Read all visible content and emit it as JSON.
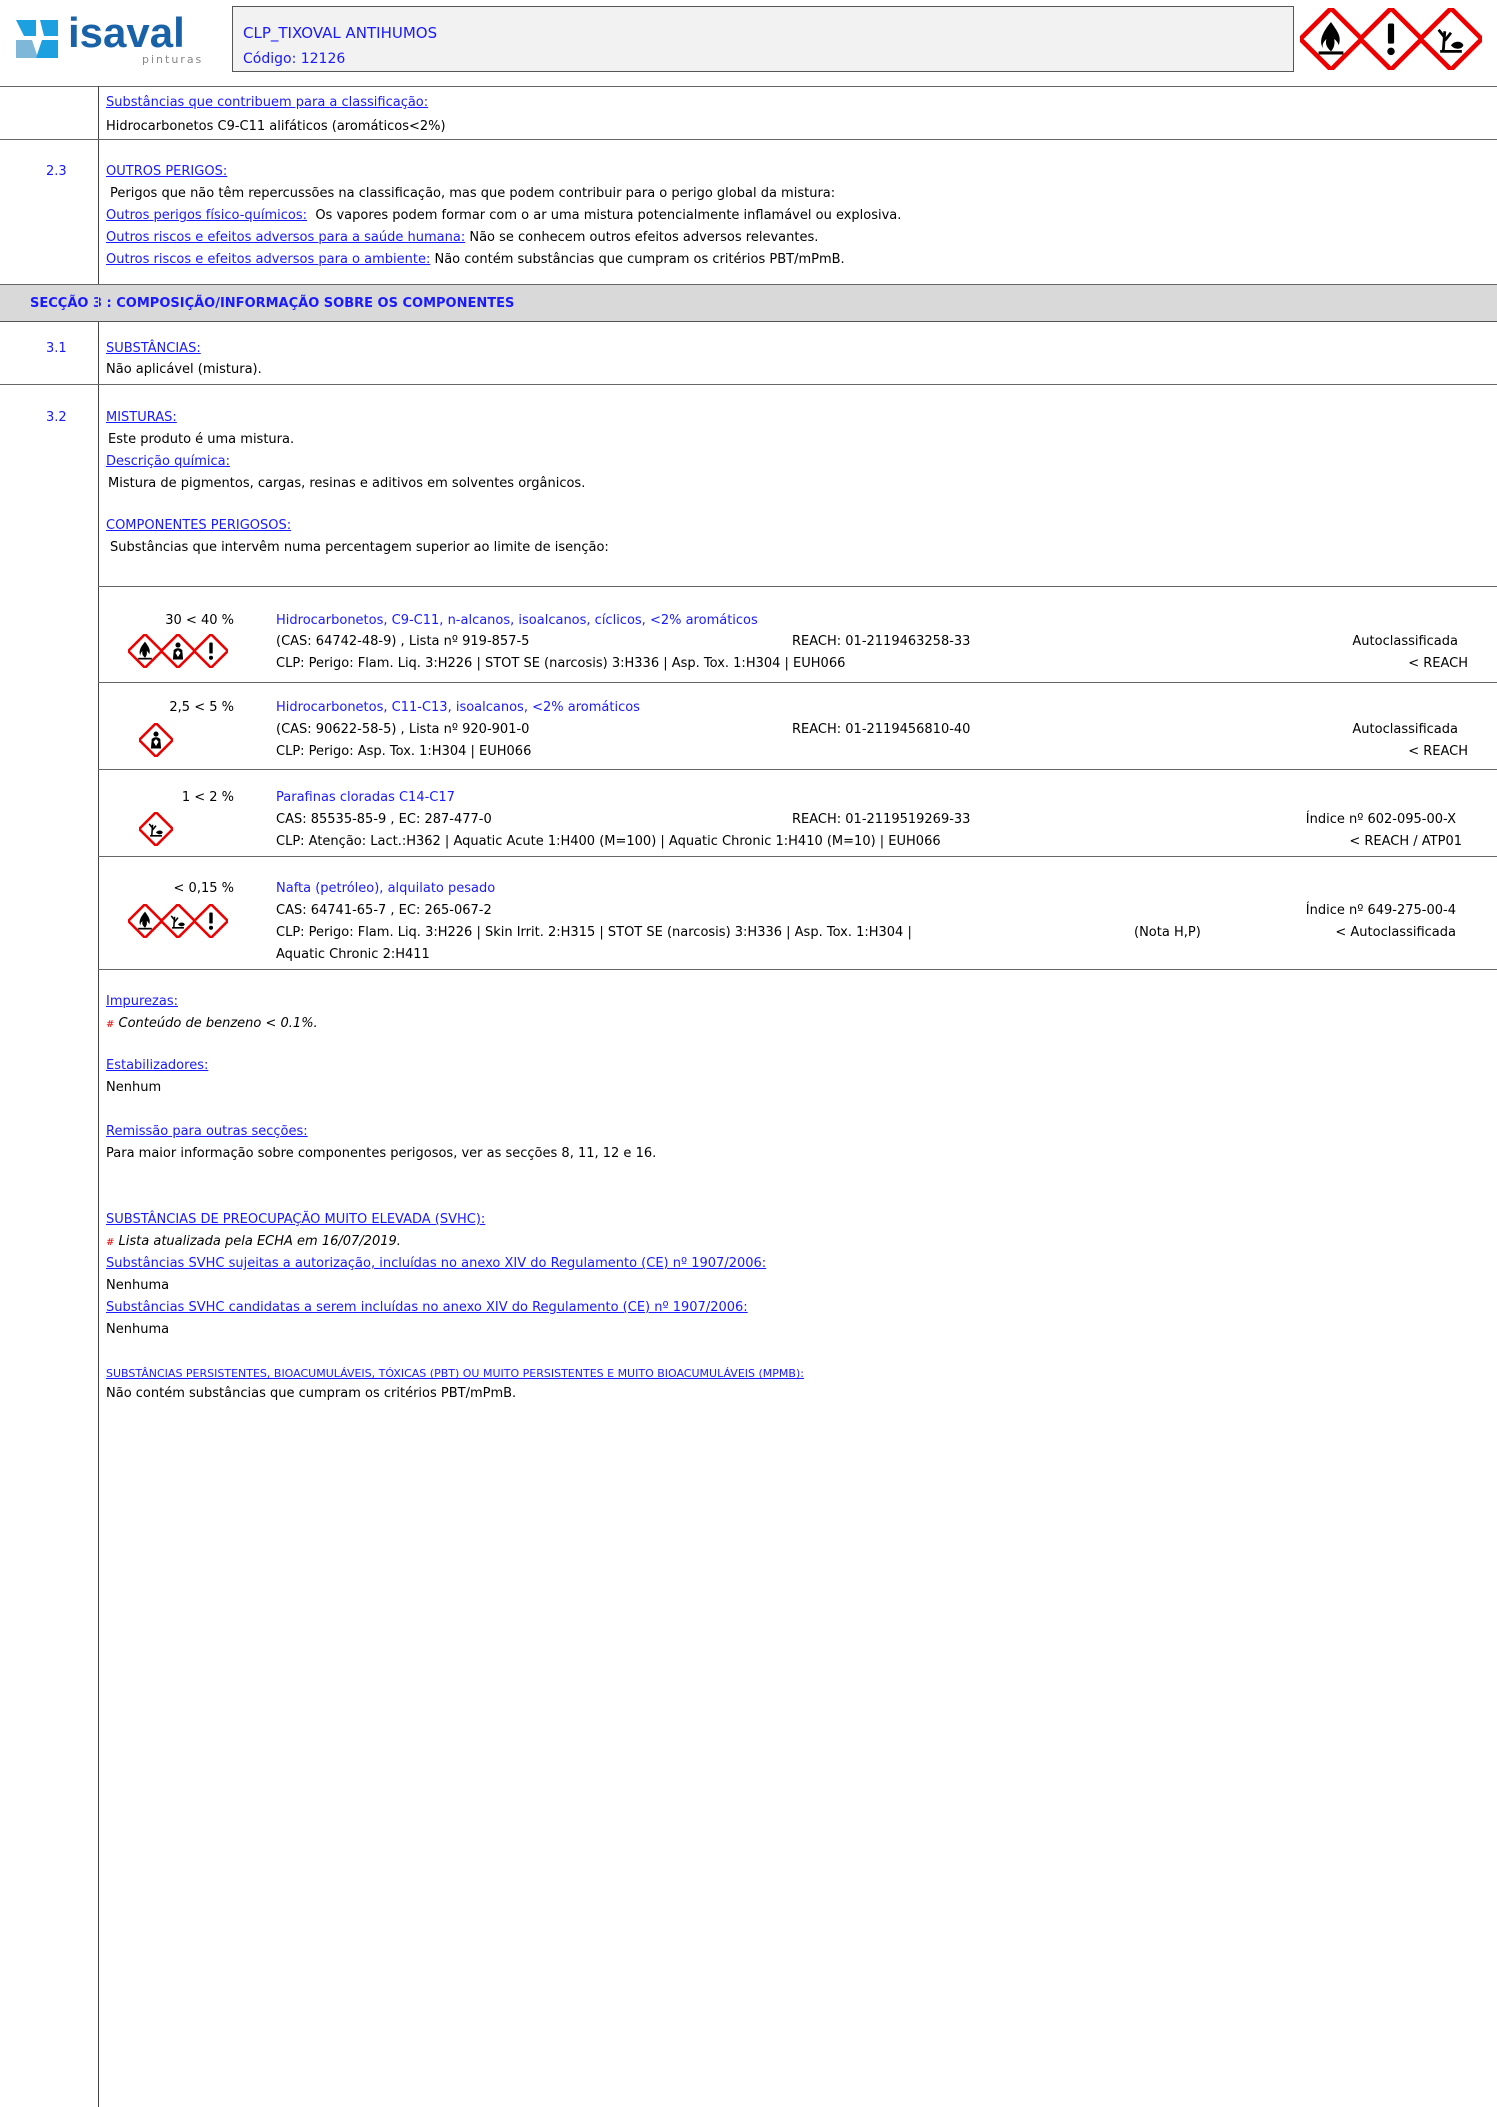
{
  "header": {
    "logo_text": "isaval",
    "logo_sub": "pinturas",
    "product": "CLP_TIXOVAL ANTIHUMOS",
    "code": "Código: 12126",
    "hazard_icons": [
      "flame-icon",
      "exclamation-icon",
      "environment-icon"
    ]
  },
  "sec2": {
    "contrib_title": "Substâncias que contribuem para a classificação:",
    "contrib_text": "Hidrocarbonetos C9-C11 alifáticos (aromáticos<2%)",
    "num_23": "2.3",
    "outros_title": "OUTROS PERIGOS:",
    "outros_intro": "Perigos que não têm repercussões na classificação, mas que podem contribuir para o perigo global da mistura:",
    "fq_label": "Outros perigos físico-químicos:",
    "fq_text": "Os vapores podem formar com o ar uma mistura potencialmente inflamável ou explosiva.",
    "saude_label": "Outros riscos e efeitos adversos para a saúde humana:",
    "saude_text": "Não se conhecem outros efeitos adversos relevantes.",
    "amb_label": "Outros riscos e efeitos adversos para o ambiente:",
    "amb_text": "Não contém substâncias que cumpram os critérios PBT/mPmB."
  },
  "sec3": {
    "title": "SECÇÃO 3 : COMPOSIÇÃO/INFORMAÇÃO SOBRE OS COMPONENTES",
    "num_31": "3.1",
    "subst_title": "SUBSTÂNCIAS:",
    "subst_text": "Não aplicável (mistura).",
    "num_32": "3.2",
    "mist_title": "MISTURAS:",
    "mist_text": "Este produto é uma mistura.",
    "desc_title": "Descrição química:",
    "desc_text": "Mistura de pigmentos, cargas, resinas e aditivos em solventes orgânicos.",
    "comp_title": "COMPONENTES PERIGOSOS:",
    "comp_intro": "Substâncias que intervêm numa percentagem superior ao limite de isenção:",
    "components": [
      {
        "pct": "30 < 40 %",
        "name": "Hidrocarbonetos, C9-C11, n-alcanos, isoalcanos, cíclicos, <2% aromáticos",
        "ids": "(CAS: 64742-48-9) , Lista nº 919-857-5",
        "reach": "REACH: 01-2119463258-33",
        "clp": "CLP: Perigo: Flam. Liq. 3:H226 | STOT SE (narcosis) 3:H336 | Asp. Tox. 1:H304 | EUH066",
        "clp2": "",
        "nota": "",
        "r1": "Autoclassificada",
        "r2": "< REACH",
        "icons": [
          "flame-icon",
          "health-hazard-icon",
          "exclamation-icon"
        ]
      },
      {
        "pct": "2,5 < 5 %",
        "name": "Hidrocarbonetos, C11-C13, isoalcanos, <2% aromáticos",
        "ids": "(CAS: 90622-58-5) , Lista nº 920-901-0",
        "reach": "REACH: 01-2119456810-40",
        "clp": "CLP: Perigo: Asp. Tox. 1:H304 | EUH066",
        "clp2": "",
        "nota": "",
        "r1": "Autoclassificada",
        "r2": "< REACH",
        "icons": [
          "health-hazard-icon"
        ]
      },
      {
        "pct": "1 < 2 %",
        "name": "Parafinas cloradas C14-C17",
        "ids": "CAS: 85535-85-9 , EC: 287-477-0",
        "reach": "REACH: 01-2119519269-33",
        "clp": "CLP: Atenção: Lact.:H362 | Aquatic Acute 1:H400 (M=100) | Aquatic Chronic 1:H410 (M=10) | EUH066",
        "clp2": "",
        "nota": "",
        "r1": "Índice nº 602-095-00-X",
        "r2": "< REACH / ATP01",
        "icons": [
          "environment-icon"
        ]
      },
      {
        "pct": "< 0,15 %",
        "name": "Nafta (petróleo), alquilato pesado",
        "ids": "CAS: 64741-65-7 , EC: 265-067-2",
        "reach": "",
        "clp": "CLP: Perigo: Flam. Liq. 3:H226 | Skin Irrit. 2:H315 | STOT SE (narcosis) 3:H336 | Asp. Tox. 1:H304 |",
        "clp2": "Aquatic Chronic 2:H411",
        "nota": "(Nota H,P)",
        "r1": "Índice nº 649-275-00-4",
        "r2": "< Autoclassificada",
        "icons": [
          "flame-icon",
          "environment-icon",
          "exclamation-icon"
        ]
      }
    ],
    "imp_title": "Impurezas:",
    "imp_text": "Conteúdo de benzeno < 0.1%.",
    "hash": "#",
    "estab_title": "Estabilizadores:",
    "estab_text": "Nenhum",
    "remis_title": "Remissão para outras secções:",
    "remis_text": "Para maior informação sobre componentes perigosos, ver as secções 8, 11, 12 e 16.",
    "svhc_title": "SUBSTÂNCIAS DE PREOCUPAÇÃO MUITO ELEVADA (SVHC):",
    "svhc_list": "Lista atualizada pela ECHA em 16/07/2019.",
    "svhc_aut_title": "Substâncias SVHC sujeitas a autorização, incluídas no anexo XIV do Regulamento (CE) nº 1907/2006:",
    "svhc_aut_text": "Nenhuma",
    "svhc_cand_title": "Substâncias SVHC candidatas a serem incluídas no anexo XIV do Regulamento (CE) nº 1907/2006:",
    "svhc_cand_text": "Nenhuma",
    "pbt_title": "SUBSTÂNCIAS PERSISTENTES, BIOACUMULÁVEIS, TÓXICAS (PBT) OU MUITO PERSISTENTES E MUITO BIOACUMULÁVEIS (MPMB):",
    "pbt_text": "Não contém substâncias que cumpram os critérios PBT/mPmB."
  }
}
